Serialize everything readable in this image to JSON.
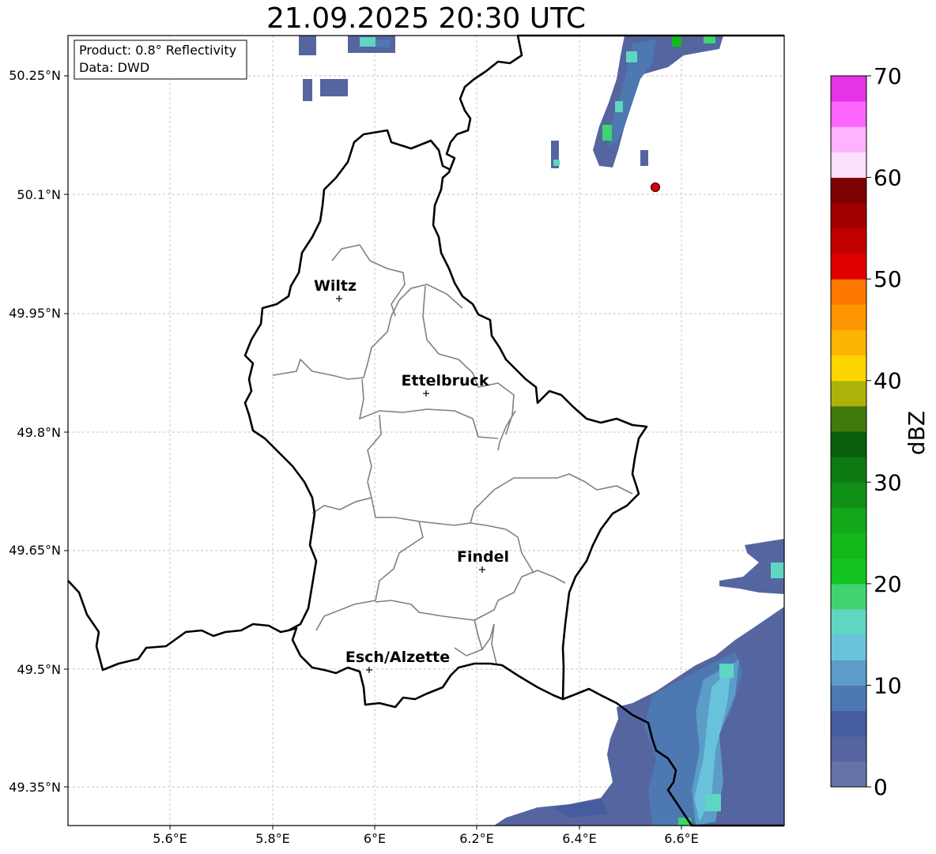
{
  "title": "21.09.2025 20:30 UTC",
  "info_box": {
    "product": "Product: 0.8° Reflectivity",
    "data": "Data: DWD"
  },
  "axes": {
    "x_ticks": [
      "5.6°E",
      "5.8°E",
      "6°E",
      "6.2°E",
      "6.4°E",
      "6.6°E"
    ],
    "y_ticks": [
      "50.25°N",
      "50.1°N",
      "49.95°N",
      "49.8°N",
      "49.65°N",
      "49.5°N",
      "49.35°N"
    ]
  },
  "cities": [
    {
      "name": "Wiltz"
    },
    {
      "name": "Ettelbruck"
    },
    {
      "name": "Findel"
    },
    {
      "name": "Esch/Alzette"
    }
  ],
  "colorbar": {
    "label": "dBZ",
    "ticks": [
      "0",
      "10",
      "20",
      "30",
      "40",
      "50",
      "60",
      "70"
    ],
    "colors": [
      "#6673a8",
      "#55659f",
      "#455ca0",
      "#4d78b2",
      "#5b9cc8",
      "#68c2dc",
      "#5fd6c2",
      "#40d470",
      "#13c421",
      "#13b81b",
      "#13a81a",
      "#108f15",
      "#0d7b12",
      "#0a5e0d",
      "#3f7a0a",
      "#adb20a",
      "#fdd600",
      "#fcb503",
      "#fd9600",
      "#fd7800",
      "#e00000",
      "#c00000",
      "#a00000",
      "#7e0000",
      "#fde0fd",
      "#fdb3fd",
      "#fd66fd",
      "#e633e6"
    ]
  },
  "colors": {
    "border_national": "#000000",
    "border_regional": "#808080",
    "radar_marker": "#e00000"
  }
}
